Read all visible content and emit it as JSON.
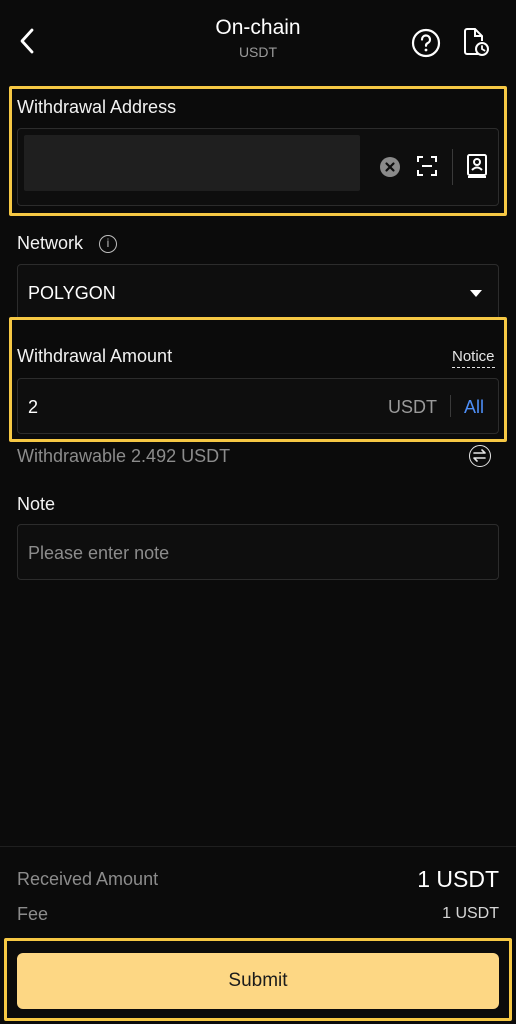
{
  "header": {
    "title": "On-chain",
    "subtitle": "USDT",
    "back_icon": "chevron-left-icon",
    "help_icon": "question-circle-icon",
    "history_icon": "document-clock-icon"
  },
  "address": {
    "label": "Withdrawal Address",
    "clear_icon": "clear-icon",
    "scan_icon": "scan-icon",
    "address_book_icon": "address-book-icon"
  },
  "network": {
    "label": "Network",
    "info_icon": "info-icon",
    "value": "POLYGON"
  },
  "amount": {
    "label": "Withdrawal Amount",
    "notice": "Notice",
    "value": "2",
    "unit": "USDT",
    "all_label": "All",
    "withdrawable": "Withdrawable 2.492 USDT",
    "swap_icon": "swap-icon"
  },
  "note": {
    "label": "Note",
    "placeholder": "Please enter note"
  },
  "summary": {
    "received_label": "Received Amount",
    "received_value": "1 USDT",
    "fee_label": "Fee",
    "fee_value": "1 USDT"
  },
  "actions": {
    "submit_label": "Submit"
  },
  "colors": {
    "highlight": "#f6c844",
    "submit_bg": "#fdd784",
    "link_blue": "#4d8ef7",
    "background": "#0b0b0b"
  }
}
